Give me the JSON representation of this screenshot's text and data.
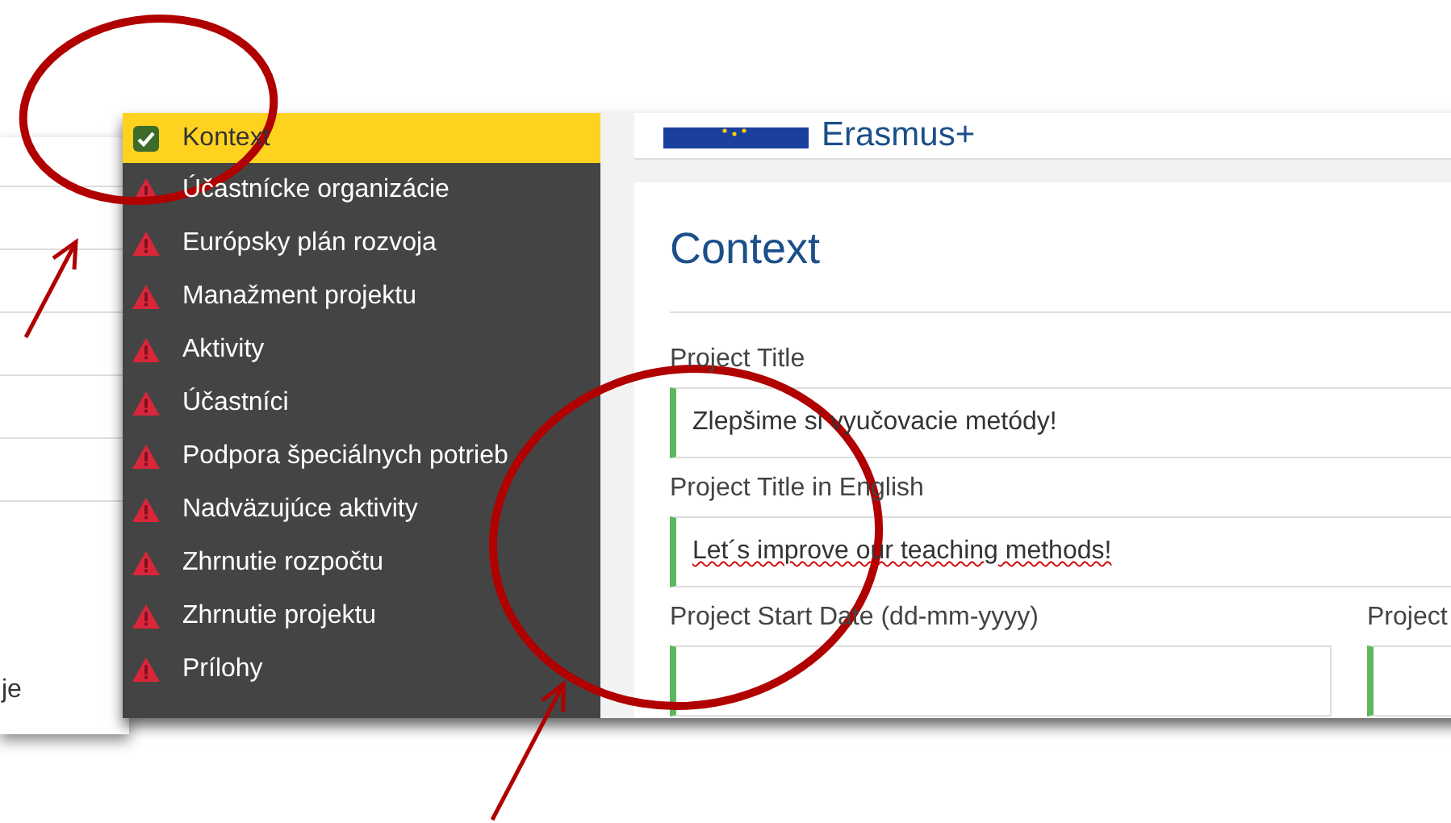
{
  "back_window": {
    "text": "je"
  },
  "sidebar": {
    "items": [
      {
        "label": "Kontext",
        "complete": true,
        "selected": true
      },
      {
        "label": "Účastnícke organizácie",
        "complete": false,
        "selected": false
      },
      {
        "label": "Európsky plán rozvoja",
        "complete": false,
        "selected": false
      },
      {
        "label": "Manažment projektu",
        "complete": false,
        "selected": false
      },
      {
        "label": "Aktivity",
        "complete": false,
        "selected": false
      },
      {
        "label": "Účastníci",
        "complete": false,
        "selected": false
      },
      {
        "label": "Podpora špeciálnych potrieb",
        "complete": false,
        "selected": false
      },
      {
        "label": "Nadväzujúce aktivity",
        "complete": false,
        "selected": false
      },
      {
        "label": "Zhrnutie rozpočtu",
        "complete": false,
        "selected": false
      },
      {
        "label": "Zhrnutie projektu",
        "complete": false,
        "selected": false
      },
      {
        "label": "Prílohy",
        "complete": false,
        "selected": false
      }
    ]
  },
  "header": {
    "logo_text": "Erasmus+"
  },
  "form": {
    "title": "Context",
    "rows": [
      [
        {
          "label": "Project Title",
          "value": "Zlepšime si vyučovacie metódy!",
          "valid": true,
          "spellcheck_error": false
        }
      ],
      [
        {
          "label": "Project Title in English",
          "value": "Let´s improve our teaching methods!",
          "valid": true,
          "spellcheck_error": true
        }
      ],
      [
        {
          "label": "Project Start Date (dd-mm-yyyy)",
          "valid": true
        },
        {
          "label": "Project",
          "valid": true
        }
      ]
    ]
  }
}
